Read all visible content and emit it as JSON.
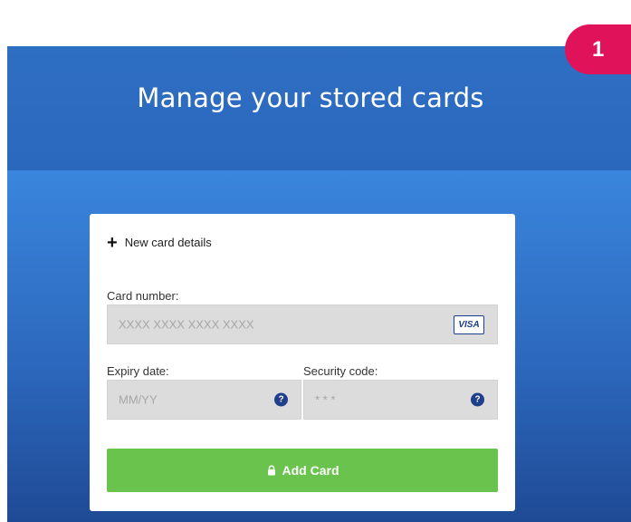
{
  "step_badge": "1",
  "header": {
    "title": "Manage your stored cards"
  },
  "form": {
    "new_card_label": "New card details",
    "card_number": {
      "label": "Card number:",
      "placeholder": "XXXX XXXX XXXX XXXX",
      "card_brand": "VISA"
    },
    "expiry": {
      "label": "Expiry date:",
      "placeholder": "MM/YY",
      "help": "?"
    },
    "security": {
      "label": "Security code:",
      "placeholder": "* * *",
      "help": "?"
    },
    "submit_label": "Add Card"
  },
  "colors": {
    "header_blue": "#2f6fc3",
    "button_green": "#69c34d",
    "badge_pink": "#e0125a"
  }
}
